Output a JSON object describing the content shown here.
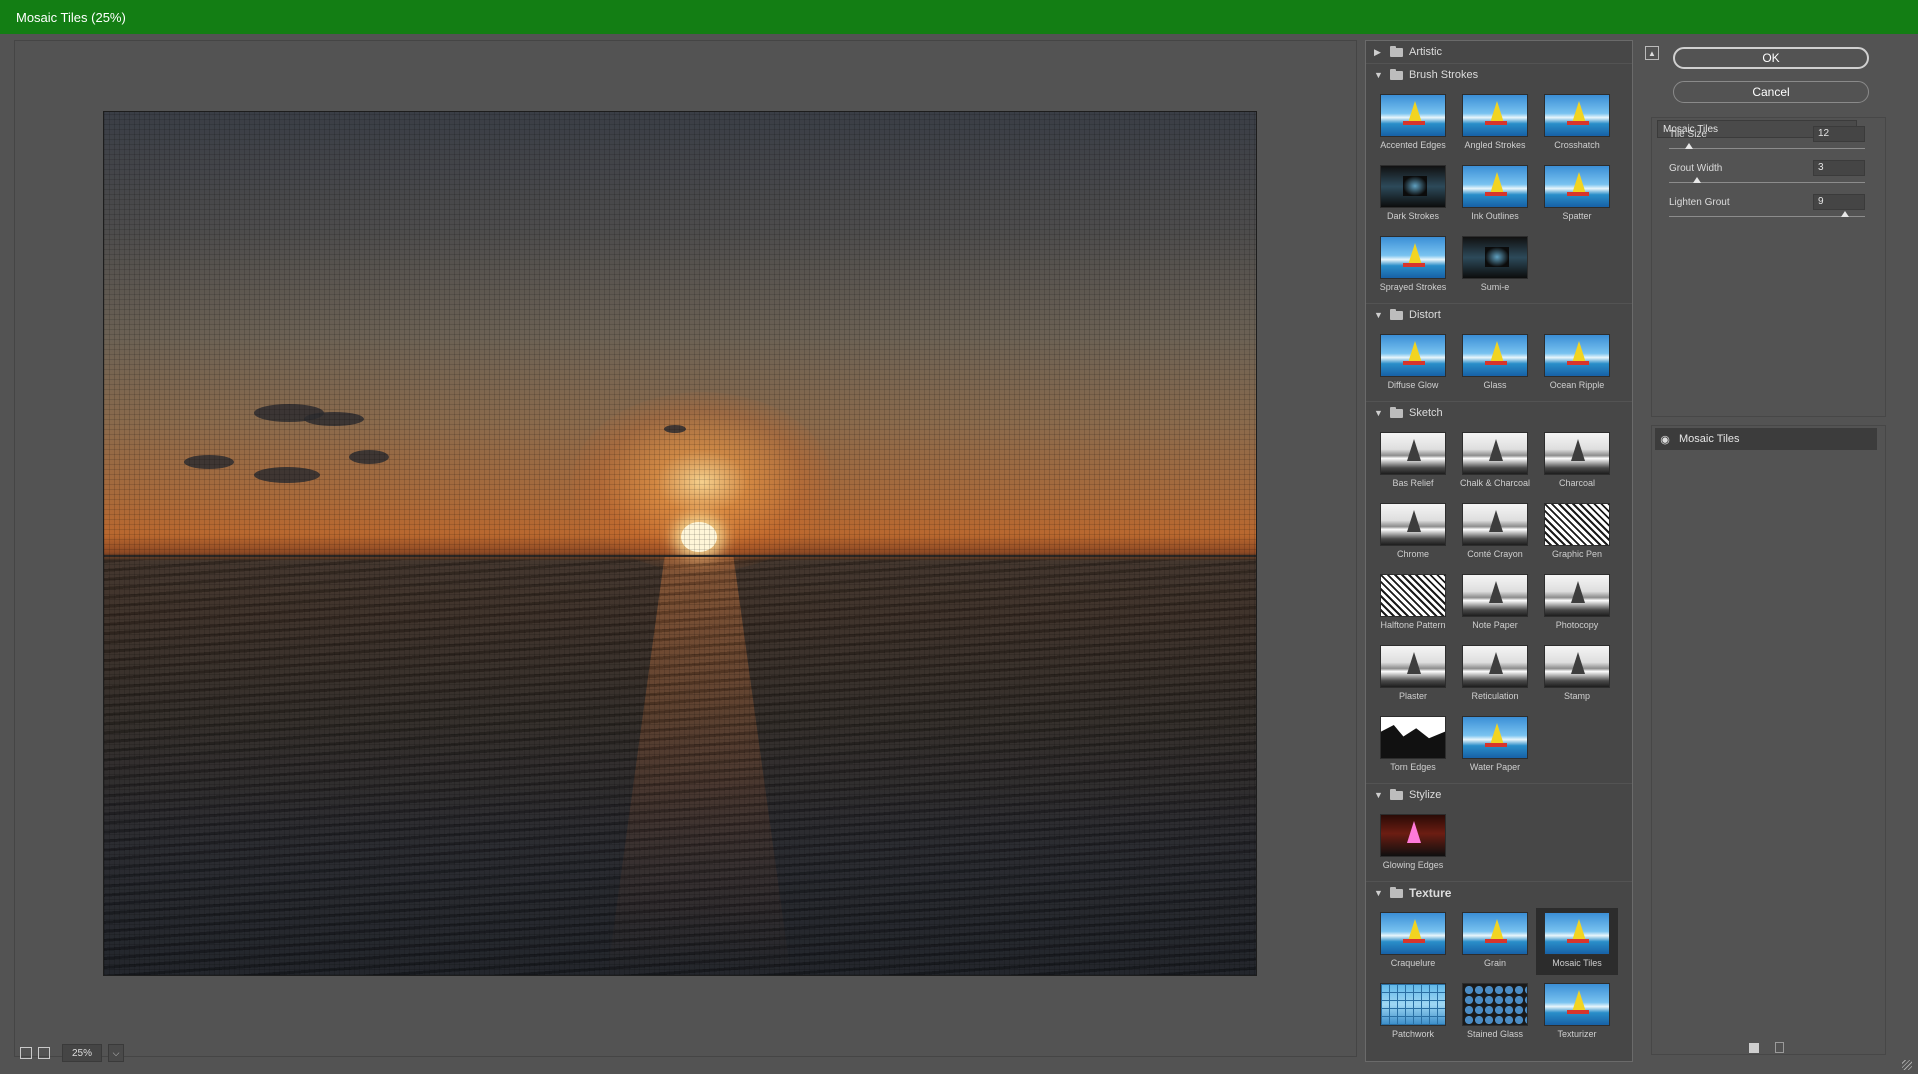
{
  "window": {
    "title": "Mosaic Tiles (25%)"
  },
  "preview": {
    "zoom": "25%",
    "zoom_arrow": "⌵"
  },
  "gallery": {
    "categories": [
      {
        "name": "Artistic",
        "expanded": false,
        "filters": []
      },
      {
        "name": "Brush Strokes",
        "expanded": true,
        "filters": [
          "Accented Edges",
          "Angled Strokes",
          "Crosshatch",
          "Dark Strokes",
          "Ink Outlines",
          "Spatter",
          "Sprayed Strokes",
          "Sumi-e"
        ]
      },
      {
        "name": "Distort",
        "expanded": true,
        "filters": [
          "Diffuse Glow",
          "Glass",
          "Ocean Ripple"
        ]
      },
      {
        "name": "Sketch",
        "expanded": true,
        "filters": [
          "Bas Relief",
          "Chalk & Charcoal",
          "Charcoal",
          "Chrome",
          "Conté Crayon",
          "Graphic Pen",
          "Halftone Pattern",
          "Note Paper",
          "Photocopy",
          "Plaster",
          "Reticulation",
          "Stamp",
          "Torn Edges",
          "Water Paper"
        ]
      },
      {
        "name": "Stylize",
        "expanded": true,
        "filters": [
          "Glowing Edges"
        ]
      },
      {
        "name": "Texture",
        "expanded": true,
        "filters": [
          "Craquelure",
          "Grain",
          "Mosaic Tiles",
          "Patchwork",
          "Stained Glass",
          "Texturizer"
        ]
      }
    ],
    "selected": "Mosaic Tiles",
    "expanded_glyph": "▼",
    "collapsed_glyph": "▶"
  },
  "buttons": {
    "ok": "OK",
    "cancel": "Cancel"
  },
  "settings": {
    "filter_select": "Mosaic Tiles",
    "select_arrow": "⌵",
    "params": [
      {
        "label": "Tile Size",
        "value": "12",
        "min": 2,
        "max": 100
      },
      {
        "label": "Grout Width",
        "value": "3",
        "min": 1,
        "max": 15
      },
      {
        "label": "Lighten Grout",
        "value": "9",
        "min": 0,
        "max": 10
      }
    ]
  },
  "layers": [
    {
      "name": "Mosaic Tiles",
      "visible": true
    }
  ],
  "icons": {
    "eye": "eye-icon",
    "collapse": "collapse-panel-icon",
    "new_layer": "new-effect-layer-icon",
    "trash": "delete-effect-layer-icon",
    "folder": "folder-icon"
  },
  "colors": {
    "titlebar": "#137e14",
    "background": "#535353",
    "panel": "#474747"
  }
}
